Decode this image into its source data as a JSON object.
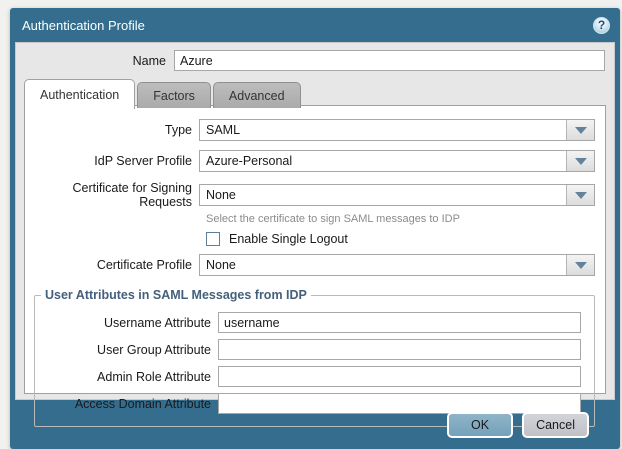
{
  "dialog": {
    "title": "Authentication Profile",
    "help_glyph": "?",
    "name_field": {
      "label": "Name",
      "value": "Azure"
    },
    "tabs": [
      {
        "label": "Authentication",
        "active": true
      },
      {
        "label": "Factors",
        "active": false
      },
      {
        "label": "Advanced",
        "active": false
      }
    ],
    "fields": {
      "type": {
        "label": "Type",
        "value": "SAML"
      },
      "idp_server_profile": {
        "label": "IdP Server Profile",
        "value": "Azure-Personal"
      },
      "certificate_signing": {
        "label": "Certificate for Signing Requests",
        "value": "None",
        "hint": "Select the certificate to sign SAML messages to IDP"
      },
      "single_logout": {
        "label": "Enable Single Logout",
        "checked": false
      },
      "certificate_profile": {
        "label": "Certificate Profile",
        "value": "None"
      }
    },
    "attributes_group": {
      "legend": "User Attributes in SAML Messages from IDP",
      "rows": [
        {
          "label": "Username Attribute",
          "value": "username"
        },
        {
          "label": "User Group Attribute",
          "value": ""
        },
        {
          "label": "Admin Role Attribute",
          "value": ""
        },
        {
          "label": "Access Domain Attribute",
          "value": ""
        }
      ]
    },
    "footer": {
      "ok_label": "OK",
      "cancel_label": "Cancel"
    },
    "colors": {
      "frame_teal": "#346d8e",
      "content_gray": "#e7e7e7",
      "ok_button": "#7ca8bd",
      "cancel_button": "#c9cbd1",
      "legend_text": "#44607c"
    }
  }
}
